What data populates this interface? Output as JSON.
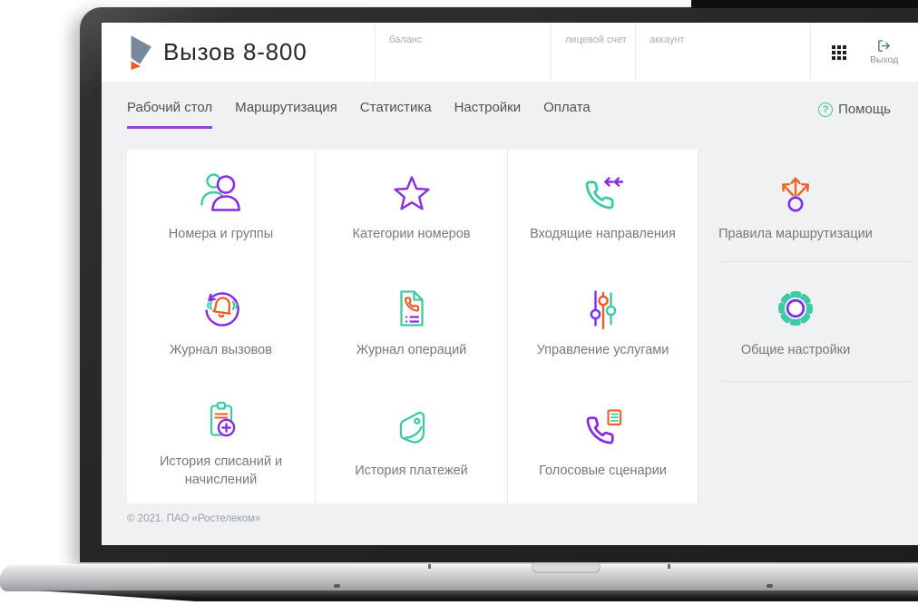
{
  "app": {
    "brand": {
      "title": "Вызов 8-800",
      "logo": "rostelecom-logo"
    },
    "header": {
      "fields": [
        {
          "label": "баланс",
          "value": ""
        },
        {
          "label": "лицевой счет",
          "value": ""
        },
        {
          "label": "аккаунт",
          "value": ""
        }
      ],
      "apps_menu": {
        "icon": "apps-grid-icon"
      },
      "logout": {
        "icon": "logout-icon",
        "label": "Выход"
      }
    },
    "nav": {
      "tabs": [
        {
          "label": "Рабочий стол",
          "active": true
        },
        {
          "label": "Маршрутизация",
          "active": false
        },
        {
          "label": "Статистика",
          "active": false
        },
        {
          "label": "Настройки",
          "active": false
        },
        {
          "label": "Оплата",
          "active": false
        }
      ],
      "help": {
        "icon_glyph": "?",
        "label": "Помощь"
      }
    },
    "dashboard": {
      "tiles": [
        {
          "label": "Номера и группы",
          "icon": "users-icon"
        },
        {
          "label": "Категории номеров",
          "icon": "star-icon"
        },
        {
          "label": "Входящие направления",
          "icon": "incoming-call-icon"
        },
        {
          "label": "Правила маршрутизации",
          "icon": "routing-arrows-icon"
        },
        {
          "label": "Журнал вызовов",
          "icon": "call-log-icon"
        },
        {
          "label": "Журнал операций",
          "icon": "operations-log-icon"
        },
        {
          "label": "Управление услугами",
          "icon": "sliders-icon"
        },
        {
          "label": "Общие настройки",
          "icon": "gear-icon"
        },
        {
          "label": "История списаний и начислений",
          "icon": "charges-history-icon"
        },
        {
          "label": "История платежей",
          "icon": "payments-history-icon"
        },
        {
          "label": "Голосовые сценарии",
          "icon": "voice-scenario-icon"
        }
      ]
    },
    "footer": {
      "copyright": "© 2021. ПАО «Ростелеком»"
    }
  },
  "colors": {
    "purple": "#8a2be2",
    "teal": "#3fc9a4",
    "orange": "#ef5b25",
    "tab_underline": "#8a46d8",
    "page_bg": "#eff1f2"
  }
}
